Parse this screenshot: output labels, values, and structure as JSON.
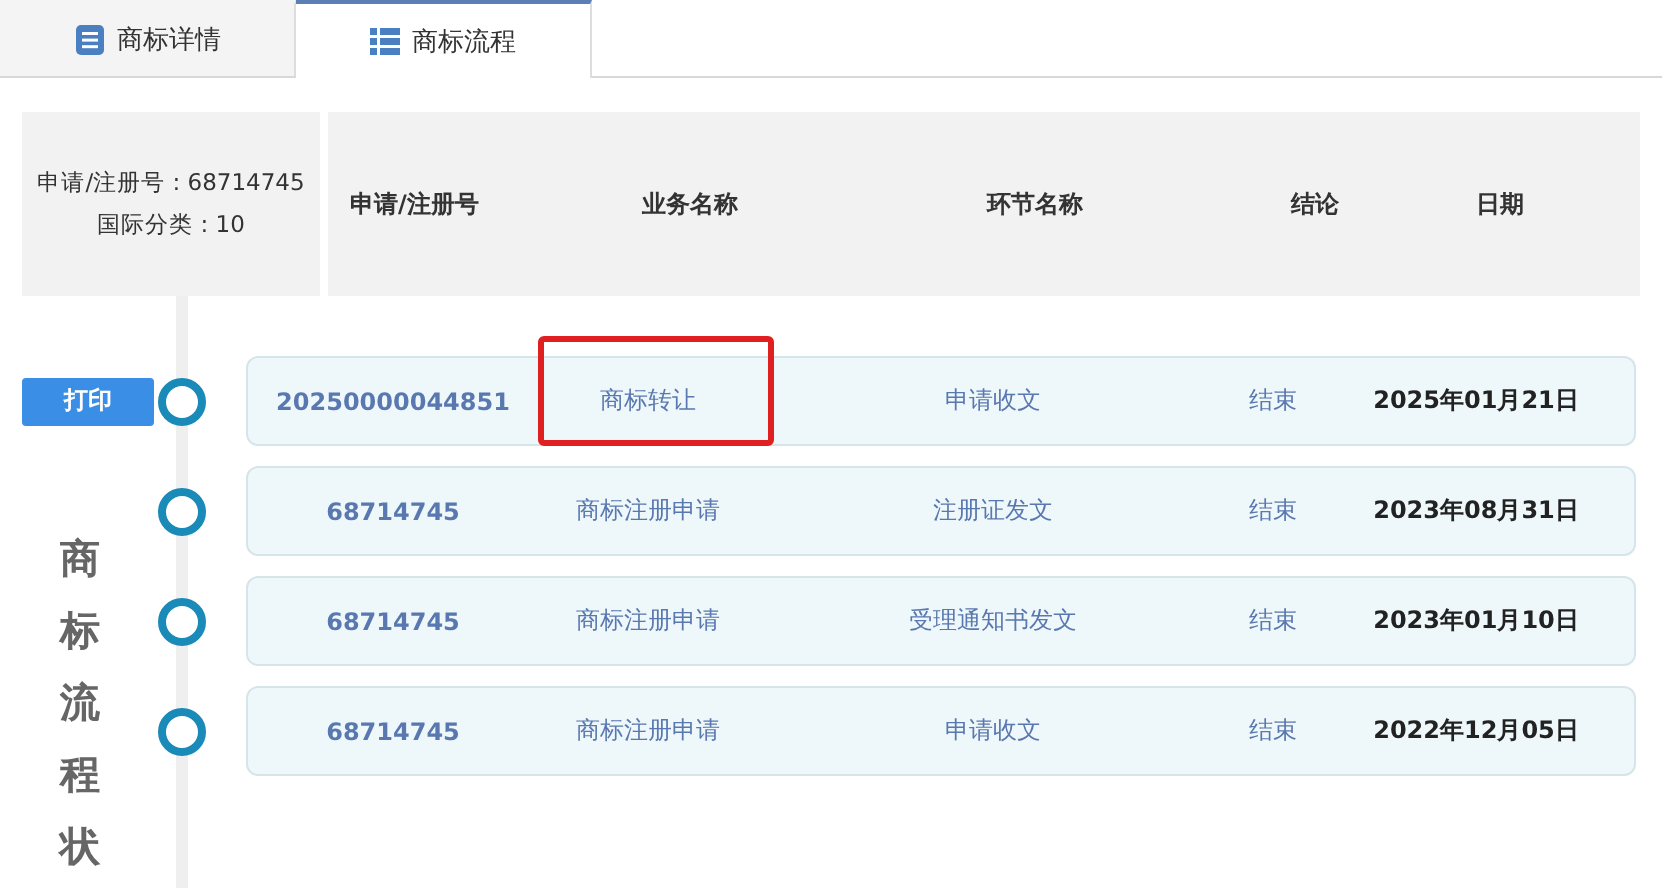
{
  "tabs": [
    {
      "label": "商标详情",
      "selected": false
    },
    {
      "label": "商标流程",
      "selected": true
    }
  ],
  "summary": {
    "reg_no": "申请/注册号 : 68714745",
    "class": "国际分类 : 10"
  },
  "columns": [
    "申请/注册号",
    "业务名称",
    "环节名称",
    "结论",
    "日期"
  ],
  "print_button": "打印",
  "side_title": "商标流程状",
  "rows": [
    {
      "number": "20250000044851",
      "business": "商标转让",
      "step": "申请收文",
      "result": "结束",
      "date": "2025年01月21日",
      "highlighted": true
    },
    {
      "number": "68714745",
      "business": "商标注册申请",
      "step": "注册证发文",
      "result": "结束",
      "date": "2023年08月31日",
      "highlighted": false
    },
    {
      "number": "68714745",
      "business": "商标注册申请",
      "step": "受理通知书发文",
      "result": "结束",
      "date": "2023年01月10日",
      "highlighted": false
    },
    {
      "number": "68714745",
      "business": "商标注册申请",
      "step": "申请收文",
      "result": "结束",
      "date": "2022年12月05日",
      "highlighted": false
    }
  ]
}
